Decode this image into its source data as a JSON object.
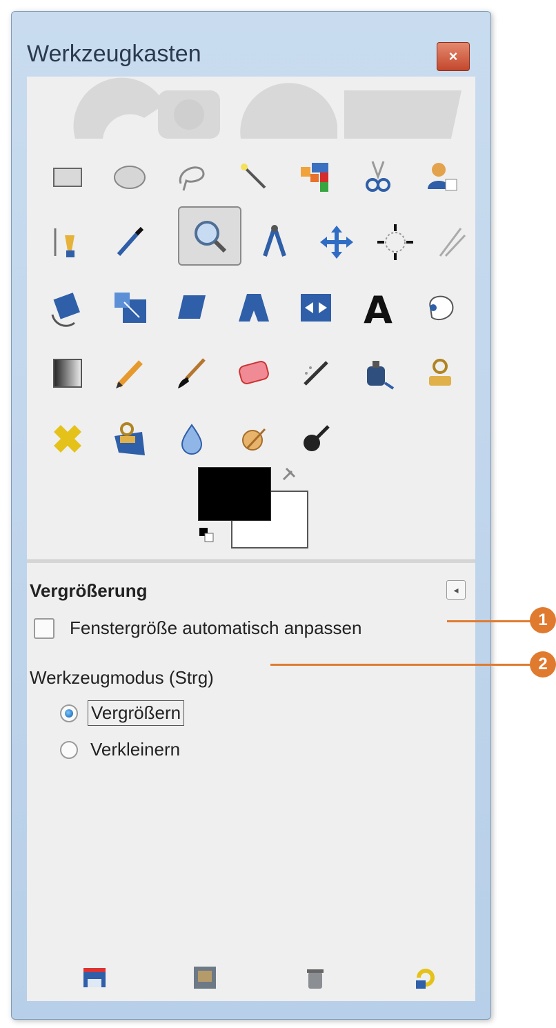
{
  "window": {
    "title": "Werkzeugkasten",
    "close_icon": "close-icon"
  },
  "tools": [
    {
      "name": "rect-select-icon"
    },
    {
      "name": "ellipse-select-icon"
    },
    {
      "name": "free-select-icon"
    },
    {
      "name": "fuzzy-select-icon"
    },
    {
      "name": "select-by-color-icon"
    },
    {
      "name": "scissors-select-icon"
    },
    {
      "name": "foreground-select-icon"
    },
    {
      "name": "paths-icon"
    },
    {
      "name": "color-picker-icon"
    },
    {
      "name": "zoom-icon",
      "selected": true
    },
    {
      "name": "measure-icon"
    },
    {
      "name": "move-icon"
    },
    {
      "name": "alignment-icon"
    },
    {
      "name": "crop-icon"
    },
    {
      "name": "rotate-icon"
    },
    {
      "name": "scale-icon"
    },
    {
      "name": "shear-icon"
    },
    {
      "name": "perspective-icon"
    },
    {
      "name": "flip-icon"
    },
    {
      "name": "text-icon"
    },
    {
      "name": "cage-transform-icon"
    },
    {
      "name": "blend-icon"
    },
    {
      "name": "pencil-icon"
    },
    {
      "name": "paintbrush-icon"
    },
    {
      "name": "eraser-icon"
    },
    {
      "name": "airbrush-icon"
    },
    {
      "name": "ink-icon"
    },
    {
      "name": "clone-icon"
    },
    {
      "name": "heal-icon"
    },
    {
      "name": "perspective-clone-icon"
    },
    {
      "name": "blur-sharpen-icon"
    },
    {
      "name": "smudge-icon"
    },
    {
      "name": "dodge-burn-icon"
    }
  ],
  "colors": {
    "foreground": "#000000",
    "background": "#ffffff"
  },
  "options": {
    "title": "Vergrößerung",
    "auto_resize_label": "Fenstergröße automatisch anpassen",
    "auto_resize_checked": false,
    "mode_label": "Werkzeugmodus (Strg)",
    "radios": [
      {
        "label": "Vergrößern",
        "checked": true
      },
      {
        "label": "Verkleinern",
        "checked": false
      }
    ]
  },
  "bottom_buttons": [
    "save-preset-icon",
    "restore-preset-icon",
    "delete-preset-icon",
    "reset-icon"
  ],
  "callouts": [
    "1",
    "2"
  ],
  "accent": "#e07a2f"
}
